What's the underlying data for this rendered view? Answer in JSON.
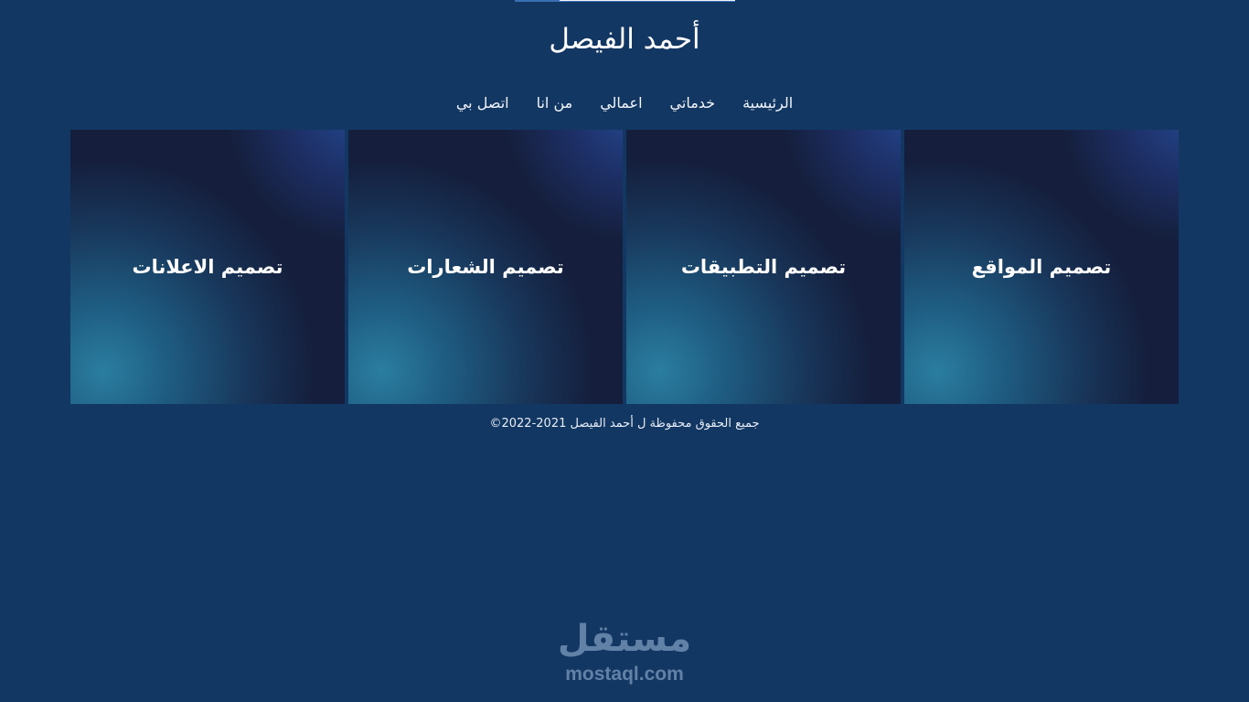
{
  "header": {
    "site_title": "أحمد الفيصل"
  },
  "nav": {
    "items": [
      {
        "label": "الرئيسية"
      },
      {
        "label": "خدماتي"
      },
      {
        "label": "اعمالي"
      },
      {
        "label": "من انا"
      },
      {
        "label": "اتصل بي"
      }
    ]
  },
  "services": {
    "cards": [
      {
        "label": "تصميم المواقع"
      },
      {
        "label": "تصميم التطبيقات"
      },
      {
        "label": "تصميم الشعارات"
      },
      {
        "label": "تصميم الاعلانات"
      }
    ]
  },
  "footer": {
    "copyright": "جميع الحقوق محفوظة ل أحمد الفيصل 2021-2022©"
  },
  "watermark": {
    "logo_text": "مستقل",
    "url": "mostaql.com"
  },
  "colors": {
    "background": "#133763",
    "card_base": "#151f3d",
    "card_glow": "#2a7ea0",
    "text": "#ffffff"
  }
}
